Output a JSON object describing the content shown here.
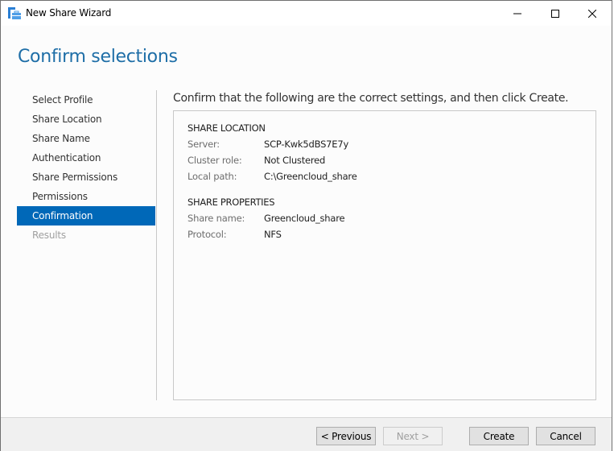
{
  "window": {
    "title": "New Share Wizard",
    "icon": "share-folder-icon",
    "controls": {
      "minimize": "minimize-icon",
      "maximize": "maximize-icon",
      "close": "close-icon"
    }
  },
  "page": {
    "title": "Confirm selections",
    "instruction": "Confirm that the following are the correct settings, and then click Create."
  },
  "nav": {
    "items": [
      {
        "label": "Select Profile",
        "state": "normal"
      },
      {
        "label": "Share Location",
        "state": "normal"
      },
      {
        "label": "Share Name",
        "state": "normal"
      },
      {
        "label": "Authentication",
        "state": "normal"
      },
      {
        "label": "Share Permissions",
        "state": "normal"
      },
      {
        "label": "Permissions",
        "state": "normal"
      },
      {
        "label": "Confirmation",
        "state": "active"
      },
      {
        "label": "Results",
        "state": "disabled"
      }
    ],
    "active_color": "#0068b8"
  },
  "summary": {
    "sections": [
      {
        "header": "SHARE LOCATION",
        "rows": [
          {
            "label": "Server:",
            "value": "SCP-Kwk5dBS7E7y"
          },
          {
            "label": "Cluster role:",
            "value": "Not Clustered"
          },
          {
            "label": "Local path:",
            "value": "C:\\Greencloud_share"
          }
        ]
      },
      {
        "header": "SHARE PROPERTIES",
        "rows": [
          {
            "label": "Share name:",
            "value": "Greencloud_share"
          },
          {
            "label": "Protocol:",
            "value": "NFS"
          }
        ]
      }
    ]
  },
  "footer": {
    "previous_label": "< Previous",
    "next_label": "Next >",
    "create_label": "Create",
    "cancel_label": "Cancel"
  }
}
